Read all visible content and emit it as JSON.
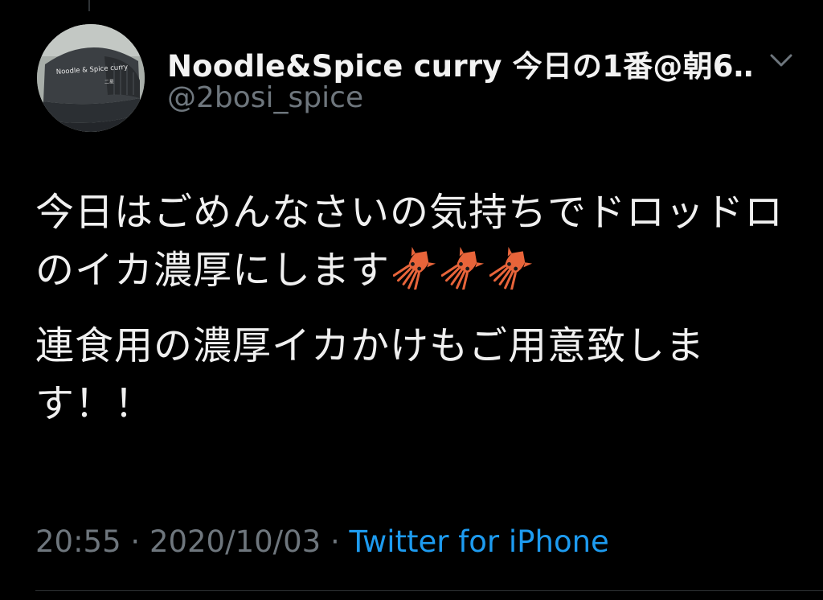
{
  "tweet": {
    "author": {
      "display_name": "Noodle&Spice curry 今日の1番@朝6…",
      "handle": "@2bosi_spice",
      "avatar_cap_text": "Noodle & Spice curry",
      "avatar_cap_subtext": "二星"
    },
    "body": {
      "paragraph_1": "今日はごめんなさいの気持ちでドロッドロのイカ濃厚にします",
      "paragraph_1_emoji": "squid",
      "paragraph_1_emoji_count": 3,
      "paragraph_2": "連食用の濃厚イカかけもご用意致します！！"
    },
    "meta": {
      "time": "20:55",
      "separator": "·",
      "date": "2020/10/03",
      "source": "Twitter for iPhone"
    }
  },
  "colors": {
    "background": "#000000",
    "text_primary": "#f0f0f0",
    "text_secondary": "#6e767d",
    "link": "#1d9bf0",
    "divider": "#2f3336",
    "squid": "#e8643a"
  },
  "icons": {
    "more_menu": "chevron-down-icon",
    "emoji": "squid-emoji-icon"
  }
}
